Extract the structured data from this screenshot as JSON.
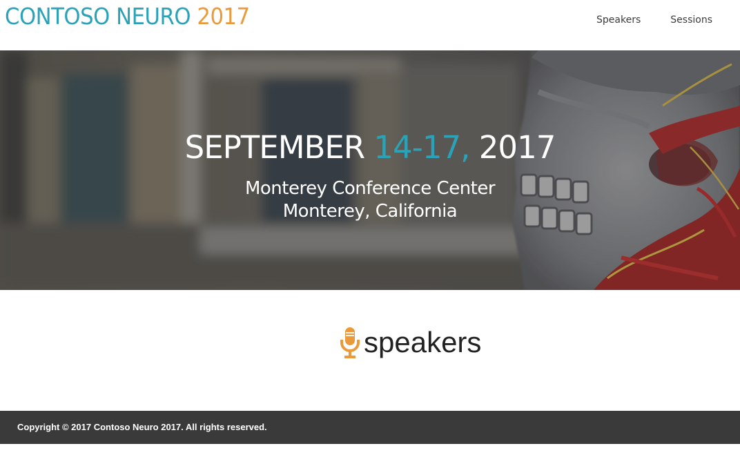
{
  "header": {
    "logo": {
      "name": "CONTOSO NEURO ",
      "year": "2017"
    },
    "nav": [
      {
        "label": "Speakers"
      },
      {
        "label": "Sessions"
      }
    ]
  },
  "hero": {
    "date": {
      "month": "SEPTEMBER ",
      "days": "14-17,",
      "year": " 2017"
    },
    "venue": {
      "line1": "Monterey Conference Center",
      "line2": "Monterey, California"
    },
    "background_icon": "anatomical-skull-image"
  },
  "speakers": {
    "icon": "microphone-icon",
    "title": "speakers"
  },
  "footer": {
    "copyright": "Copyright © 2017 Contoso Neuro 2017. All rights reserved."
  },
  "colors": {
    "accent_teal": "#2aa3b8",
    "accent_orange": "#ea9a3a",
    "footer_bg": "#3a3a3a"
  }
}
